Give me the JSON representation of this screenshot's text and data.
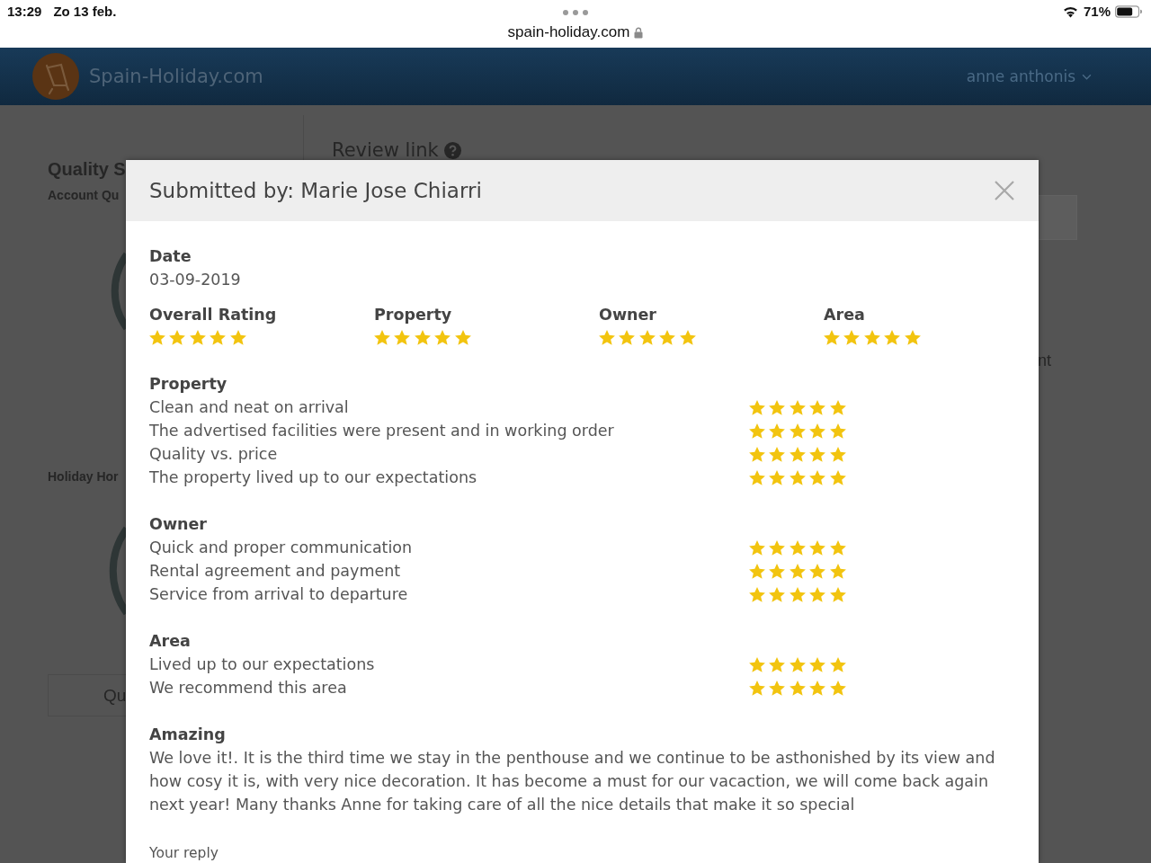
{
  "status_bar": {
    "time": "13:29",
    "date": "Zo 13 feb.",
    "url": "spain-holiday.com",
    "battery": "71%"
  },
  "header": {
    "logo": "Spain-Holiday.com",
    "user": "anne anthonis"
  },
  "background": {
    "sidebar": {
      "title": "Quality S",
      "subtitle": "Account Qu",
      "section": "Holiday Hor",
      "button": "Qu"
    },
    "main": {
      "heading": "Review link",
      "text": "nt"
    }
  },
  "modal": {
    "title": "Submitted by: Marie Jose Chiarri",
    "date_label": "Date",
    "date": "03-09-2019",
    "overall": [
      {
        "label": "Overall Rating",
        "stars": 5
      },
      {
        "label": "Property",
        "stars": 5
      },
      {
        "label": "Owner",
        "stars": 5
      },
      {
        "label": "Area",
        "stars": 5
      }
    ],
    "sections": [
      {
        "title": "Property",
        "items": [
          {
            "label": "Clean and neat on arrival",
            "stars": 5
          },
          {
            "label": "The advertised facilities were present and in working order",
            "stars": 5
          },
          {
            "label": "Quality vs. price",
            "stars": 5
          },
          {
            "label": "The property lived up to our expectations",
            "stars": 5
          }
        ]
      },
      {
        "title": "Owner",
        "items": [
          {
            "label": "Quick and proper communication",
            "stars": 5
          },
          {
            "label": "Rental agreement and payment",
            "stars": 5
          },
          {
            "label": "Service from arrival to departure",
            "stars": 5
          }
        ]
      },
      {
        "title": "Area",
        "items": [
          {
            "label": "Lived up to our expectations",
            "stars": 5
          },
          {
            "label": "We recommend this area",
            "stars": 5
          }
        ]
      }
    ],
    "review": {
      "title": "Amazing",
      "text": "We love it!. It is the third time we stay in the penthouse and we continue to be asthonished by its view and how cosy it is, with very nice decoration. It has become a must for our vacaction, we will come back again next year! Many thanks Anne for taking care of all the nice details that make it so special"
    },
    "reply_label": "Your reply"
  }
}
